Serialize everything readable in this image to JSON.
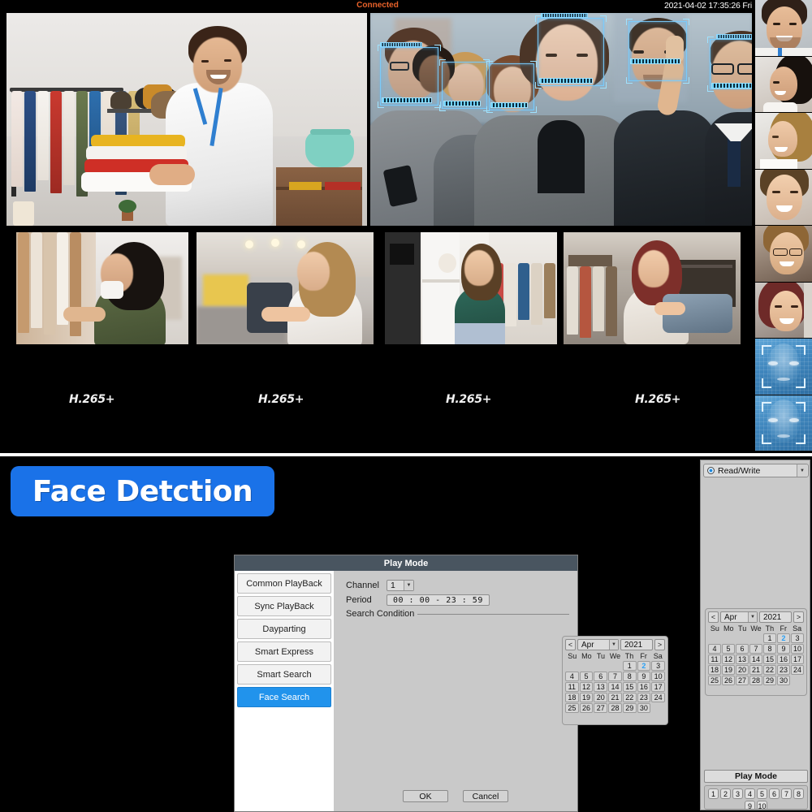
{
  "status_bar": {
    "connection": "Connected",
    "timestamp": "2021-04-02 17:35:26 Fri"
  },
  "live_view": {
    "codec_labels": [
      "H.265+",
      "H.265+",
      "H.265+",
      "H.265+"
    ],
    "panels": [
      {
        "name": "retail-store-clerk",
        "detections": 0
      },
      {
        "name": "street-crowd-face-detection",
        "detections": 6
      },
      {
        "name": "shopper-browsing-rack",
        "detections": 0
      },
      {
        "name": "shopper-holding-garment",
        "detections": 0
      },
      {
        "name": "shopper-in-boutique",
        "detections": 0
      },
      {
        "name": "shopper-at-clothing-rail",
        "detections": 0
      }
    ],
    "detection_box_color": "#7fd8ff"
  },
  "thumbnails": [
    {
      "label": "face-thumb-1",
      "type": "photo"
    },
    {
      "label": "face-thumb-2",
      "type": "photo"
    },
    {
      "label": "face-thumb-3",
      "type": "photo"
    },
    {
      "label": "face-thumb-4",
      "type": "photo"
    },
    {
      "label": "face-thumb-5",
      "type": "photo"
    },
    {
      "label": "face-thumb-6",
      "type": "photo"
    },
    {
      "label": "face-scan-thumb-1",
      "type": "biometric-scan"
    },
    {
      "label": "face-scan-thumb-2",
      "type": "biometric-scan"
    }
  ],
  "banner": {
    "text": "Face Detction",
    "background": "#1a72e8",
    "text_color": "#ffffff"
  },
  "dialog": {
    "title": "Play Mode",
    "title_bar_color": "#495560",
    "accent_color": "#2193ec",
    "modes": [
      {
        "label": "Common PlayBack",
        "selected": false
      },
      {
        "label": "Sync PlayBack",
        "selected": false
      },
      {
        "label": "Dayparting",
        "selected": false
      },
      {
        "label": "Smart Express",
        "selected": false
      },
      {
        "label": "Smart Search",
        "selected": false
      },
      {
        "label": "Face Search",
        "selected": true
      }
    ],
    "channel": {
      "label": "Channel",
      "value": "1"
    },
    "period": {
      "label": "Period",
      "value": "00 : 00   -   23 : 59"
    },
    "search_condition_label": "Search Condition",
    "calendar": {
      "prev": "<",
      "next": ">",
      "month": "Apr",
      "year": "2021",
      "dow": [
        "Su",
        "Mo",
        "Tu",
        "We",
        "Th",
        "Fr",
        "Sa"
      ],
      "lead_blanks": 4,
      "days": [
        1,
        2,
        3,
        4,
        5,
        6,
        7,
        8,
        9,
        10,
        11,
        12,
        13,
        14,
        15,
        16,
        17,
        18,
        19,
        20,
        21,
        22,
        23,
        24,
        25,
        26,
        27,
        28,
        29,
        30
      ],
      "selected_day": 2
    },
    "buttons": {
      "ok": "OK",
      "cancel": "Cancel"
    }
  },
  "right_panel": {
    "storage_mode": {
      "label": "Read/Write",
      "selected": true
    },
    "calendar": {
      "prev": "<",
      "next": ">",
      "month": "Apr",
      "year": "2021",
      "dow": [
        "Su",
        "Mo",
        "Tu",
        "We",
        "Th",
        "Fr",
        "Sa"
      ],
      "lead_blanks": 4,
      "days": [
        1,
        2,
        3,
        4,
        5,
        6,
        7,
        8,
        9,
        10,
        11,
        12,
        13,
        14,
        15,
        16,
        17,
        18,
        19,
        20,
        21,
        22,
        23,
        24,
        25,
        26,
        27,
        28,
        29,
        30
      ],
      "selected_day": 2
    },
    "play_mode_button": "Play Mode",
    "channels": [
      "1",
      "2",
      "3",
      "4",
      "5",
      "6",
      "7",
      "8"
    ],
    "channels_row2": [
      "9",
      "10"
    ]
  }
}
